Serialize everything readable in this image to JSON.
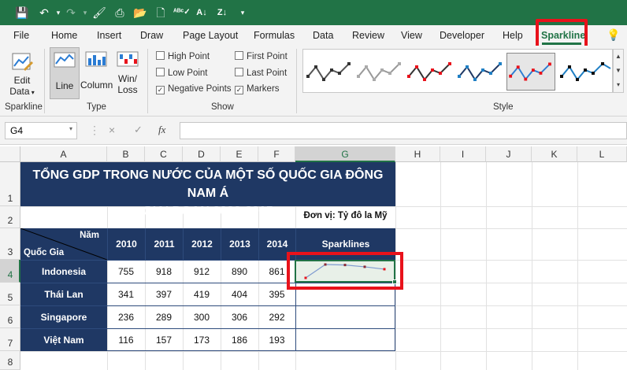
{
  "qat": {
    "icons": [
      "save-icon",
      "undo-icon",
      "redo-icon",
      "paint-icon",
      "print-preview-icon",
      "open-folder-icon",
      "new-file-icon",
      "spelling-icon",
      "sort-asc-icon",
      "sort-desc-icon",
      "customize-icon"
    ]
  },
  "tabs": [
    "File",
    "Home",
    "Insert",
    "Draw",
    "Page Layout",
    "Formulas",
    "Data",
    "Review",
    "View",
    "Developer",
    "Help",
    "Sparkline"
  ],
  "active_tab": "Sparkline",
  "ribbon": {
    "sparkline_group": {
      "edit_label_1": "Edit",
      "edit_label_2": "Data",
      "label": "Sparkline"
    },
    "type_group": {
      "line": "Line",
      "column": "Column",
      "winloss_1": "Win/",
      "winloss_2": "Loss",
      "label": "Type"
    },
    "show_group": {
      "high_point": "High Point",
      "low_point": "Low Point",
      "negative_points": "Negative Points",
      "first_point": "First Point",
      "last_point": "Last Point",
      "markers": "Markers",
      "label": "Show",
      "negative_points_checked": true,
      "markers_checked": true
    },
    "style_group": {
      "label": "Style"
    }
  },
  "formula_bar": {
    "name_box": "G4",
    "cancel": "×",
    "enter": "✓",
    "fx": "fx",
    "value": ""
  },
  "columns": [
    "A",
    "B",
    "C",
    "D",
    "E",
    "F",
    "G",
    "H",
    "I",
    "J",
    "K",
    "L"
  ],
  "rows": [
    "1",
    "2",
    "3",
    "4",
    "5",
    "6",
    "7",
    "8"
  ],
  "sheet": {
    "title_line1": "TỔNG GDP TRONG NƯỚC CỦA MỘT SỐ QUỐC GIA ĐÔNG NAM Á",
    "title_line2": "GIAI ĐOẠN 2020-2015",
    "unit": "Đơn vị: Tỷ đô la Mỹ",
    "header_year": "Năm",
    "header_country": "Quốc Gia",
    "years": [
      "2010",
      "2011",
      "2012",
      "2013",
      "2014"
    ],
    "sparklines_header": "Sparklines",
    "data": [
      {
        "country": "Indonesia",
        "values": [
          "755",
          "918",
          "912",
          "890",
          "861"
        ]
      },
      {
        "country": "Thái Lan",
        "values": [
          "341",
          "397",
          "419",
          "404",
          "395"
        ]
      },
      {
        "country": "Singapore",
        "values": [
          "236",
          "289",
          "300",
          "306",
          "292"
        ]
      },
      {
        "country": "Việt Nam",
        "values": [
          "116",
          "157",
          "173",
          "186",
          "193"
        ]
      }
    ]
  },
  "colors": {
    "accent": "#217346",
    "header_fill": "#1f3864",
    "highlight_box": "#e8121b",
    "marker": "#e8121b"
  }
}
